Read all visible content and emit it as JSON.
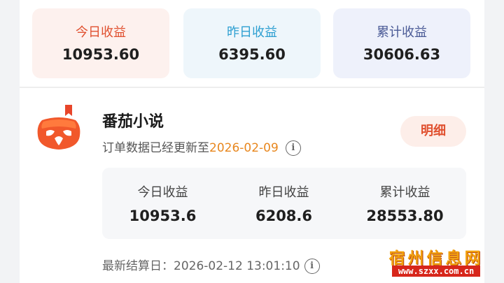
{
  "summary_cards": [
    {
      "label": "今日收益",
      "value": "10953.60"
    },
    {
      "label": "昨日收益",
      "value": "6395.60"
    },
    {
      "label": "累计收益",
      "value": "30606.63"
    }
  ],
  "app_section": {
    "name": "番茄小说",
    "update_prefix": "订单数据已经更新至",
    "update_date": "2026-02-09",
    "detail_button": "明细",
    "stats": [
      {
        "label": "今日收益",
        "value": "10953.6"
      },
      {
        "label": "昨日收益",
        "value": "6208.6"
      },
      {
        "label": "累计收益",
        "value": "28553.80"
      }
    ],
    "settle_label": "最新结算日：",
    "settle_time": "2026-02-12 13:01:10"
  },
  "watermark": {
    "title": "宿州信息网",
    "url": "www.szxx.com.cn"
  },
  "colors": {
    "accent": "#e0502f",
    "date_highlight": "#e8871e",
    "card_today_bg": "#fdf1ee",
    "card_yesterday_bg": "#eef6fb",
    "card_total_bg": "#eef1fb"
  },
  "icons": [
    "tomato-logo-icon",
    "info-icon"
  ]
}
